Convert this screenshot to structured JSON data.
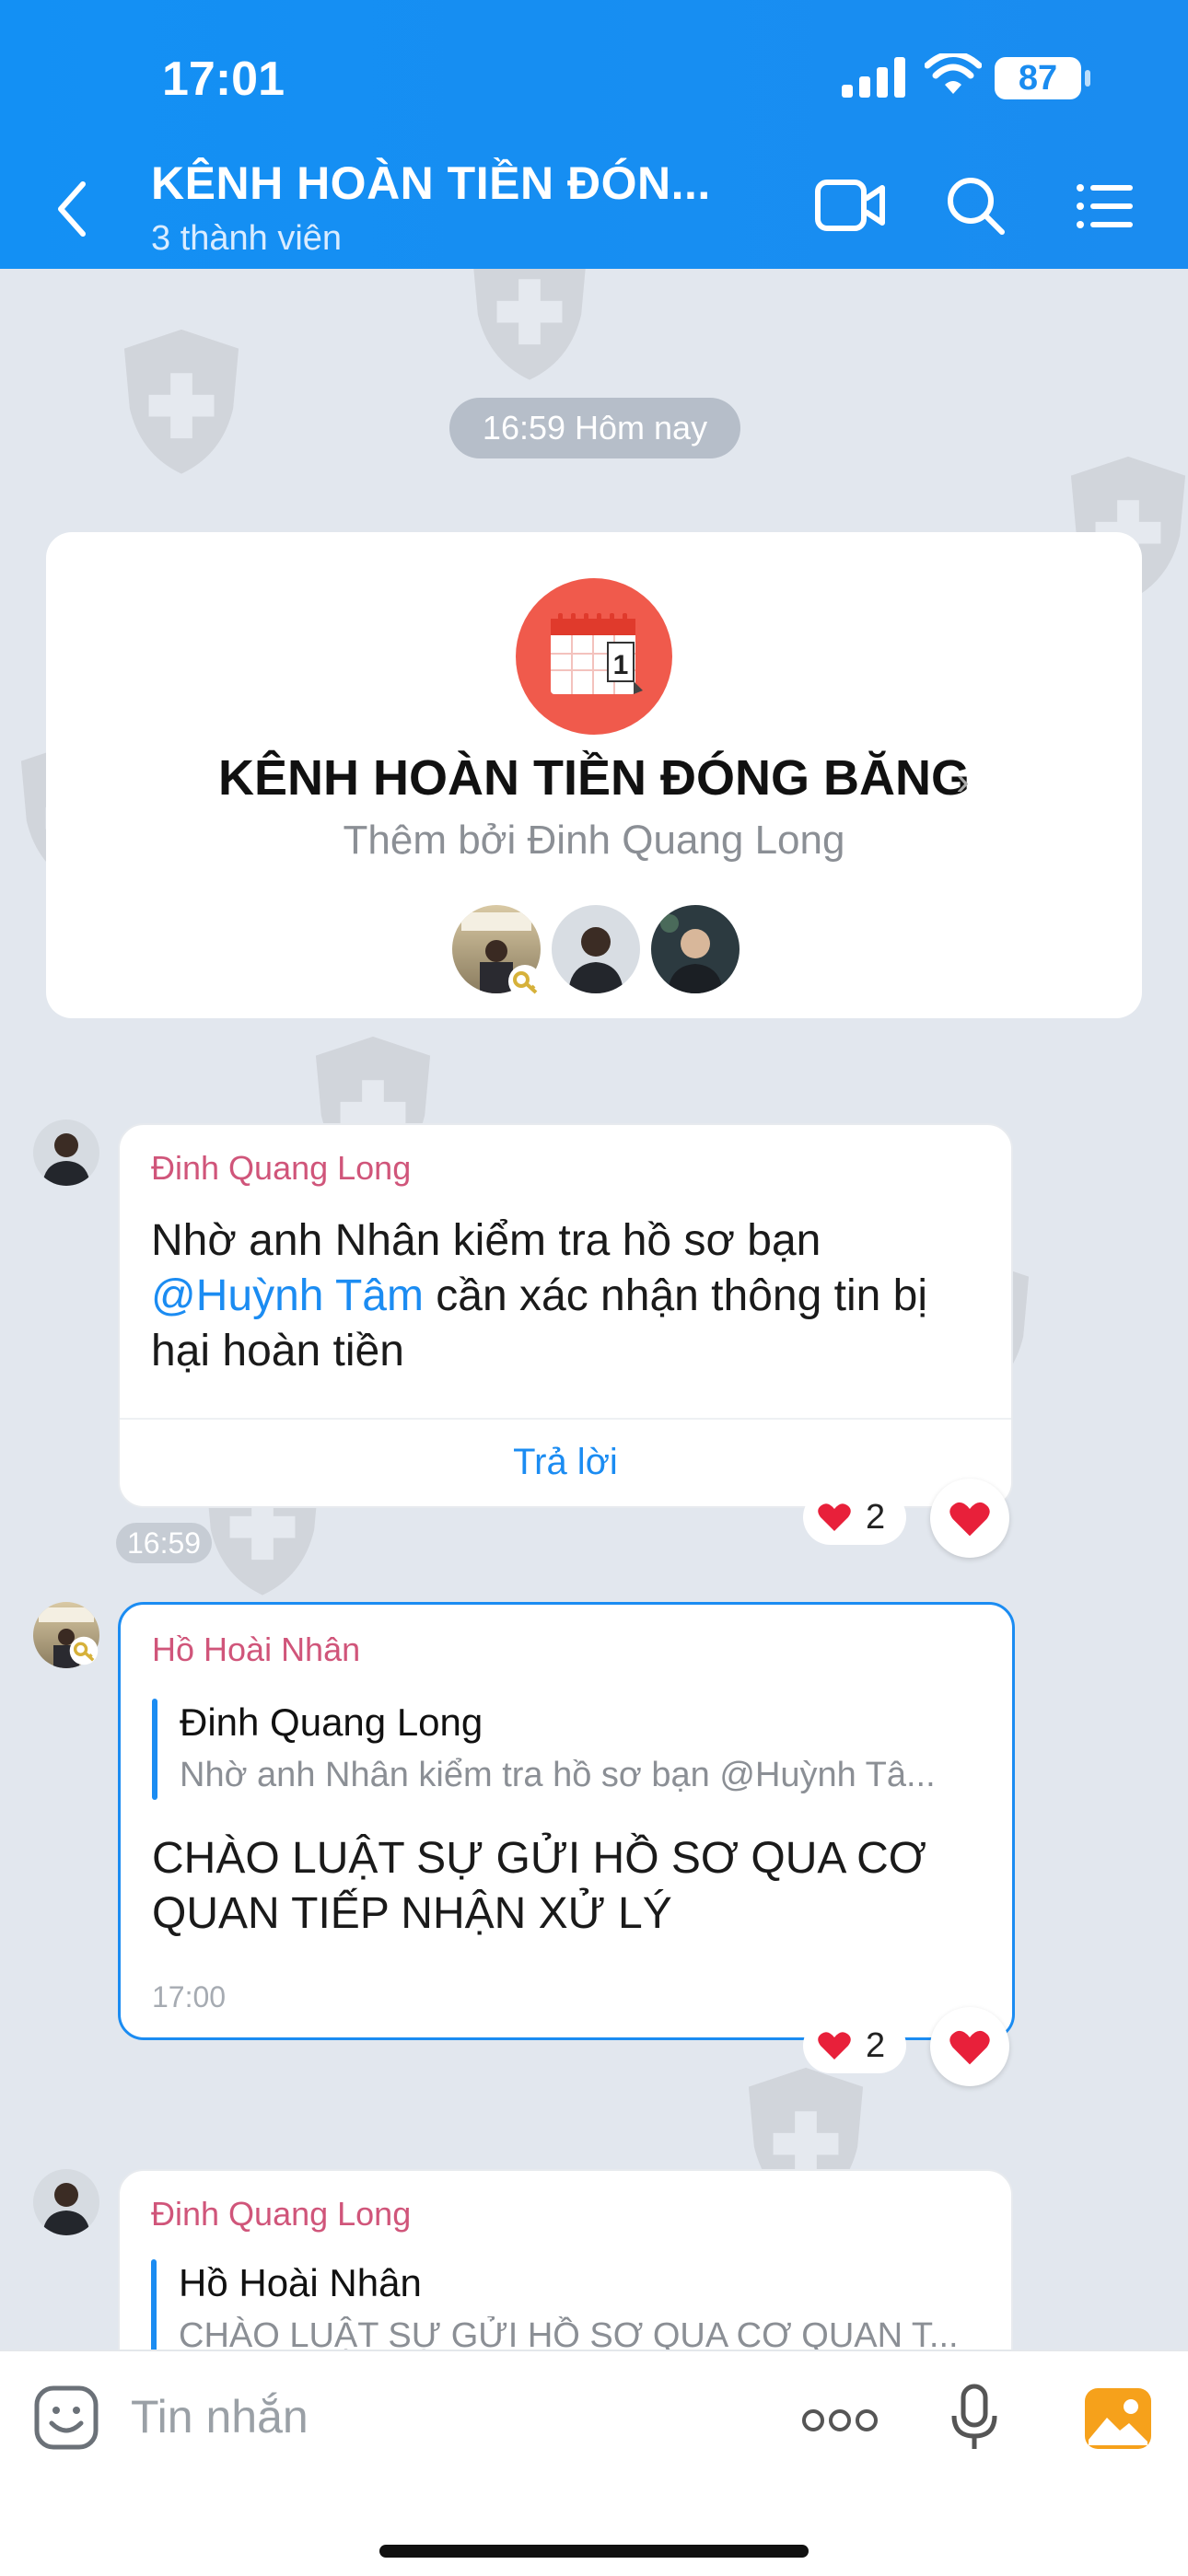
{
  "status_bar": {
    "time": "17:01",
    "battery": "87"
  },
  "header": {
    "title": "KÊNH HOÀN TIỀN ĐÓN...",
    "subtitle": "3 thành viên",
    "icons": [
      "back-icon",
      "video-call-icon",
      "search-icon",
      "menu-icon"
    ]
  },
  "date_separator": "16:59 Hôm nay",
  "group_card": {
    "name": "KÊNH HOÀN TIỀN ĐÓNG BĂNG",
    "added_by": "Thêm bởi Đinh Quang Long",
    "avatar_icon": "calendar-icon",
    "avatar_number": "1",
    "members": [
      "member-1",
      "member-2",
      "member-3"
    ]
  },
  "messages": [
    {
      "sender": "Đinh Quang Long",
      "text_line1": "Nhờ anh Nhân kiểm tra hồ sơ bạn",
      "mention": "@Huỳnh Tâm",
      "text_line2_rest": " cần xác nhận thông tin bị",
      "text_line3": "hại hoàn tiền",
      "reply_label": "Trả lời",
      "time": "16:59",
      "reaction_count": "2"
    },
    {
      "sender": "Hồ Hoài Nhân",
      "quote_name": "Đinh Quang Long",
      "quote_text": "Nhờ anh Nhân kiểm tra hồ sơ bạn @Huỳnh Tâ...",
      "text_line1": "CHÀO LUẬT SỰ GỬI HỒ SƠ QUA CƠ",
      "text_line2": "QUAN TIẾP NHẬN XỬ LÝ",
      "time": "17:00",
      "reaction_count": "2"
    },
    {
      "sender": "Đinh Quang Long",
      "quote_name": "Hồ Hoài Nhân",
      "quote_text": "CHÀO LUẬT SỰ GỬI HỒ SƠ QUA CƠ QUAN T..."
    }
  ],
  "input_bar": {
    "placeholder": "Tin nhắn"
  },
  "colors": {
    "header_blue": "#1a8cf0",
    "accent_blue": "#1b8cf2",
    "sender_pink": "#d0557a",
    "heart_red": "#e8203a"
  }
}
